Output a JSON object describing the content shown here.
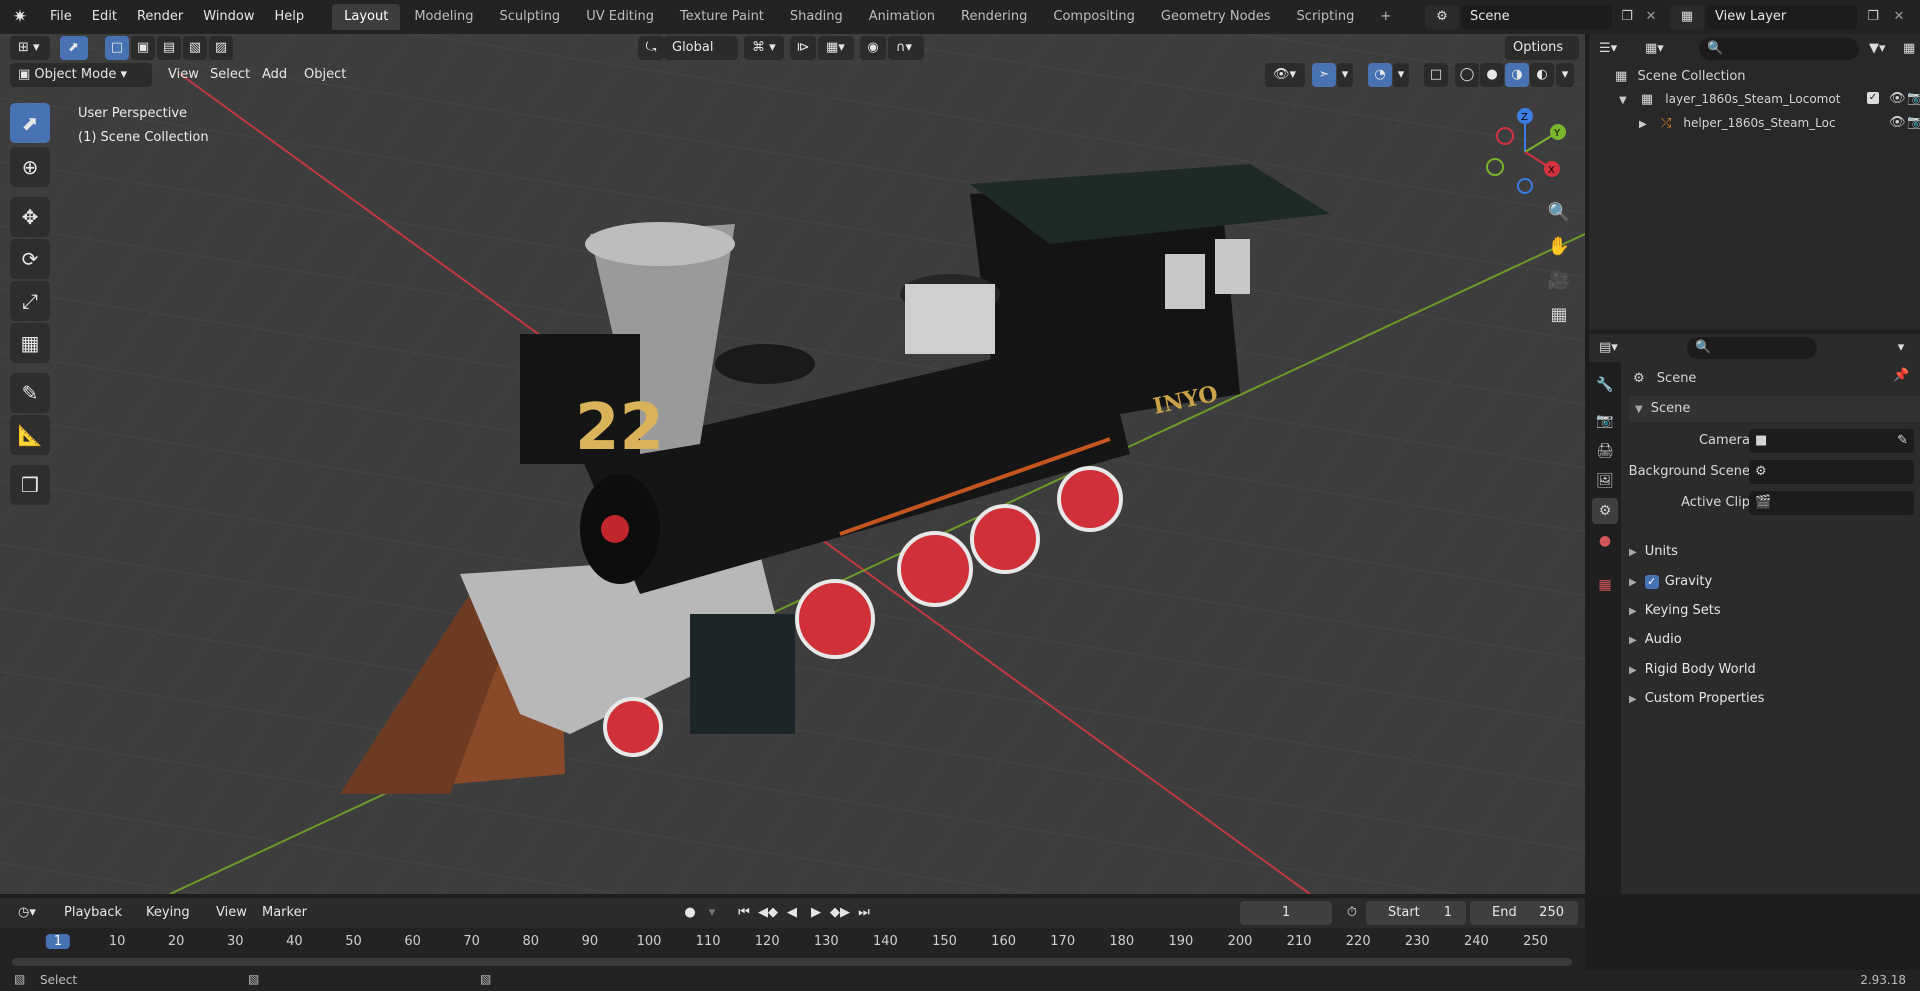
{
  "topbar": {
    "menus": [
      "File",
      "Edit",
      "Render",
      "Window",
      "Help"
    ],
    "workspaces": [
      "Layout",
      "Modeling",
      "Sculpting",
      "UV Editing",
      "Texture Paint",
      "Shading",
      "Animation",
      "Rendering",
      "Compositing",
      "Geometry Nodes",
      "Scripting"
    ],
    "active_workspace": "Layout",
    "add_tab": "+",
    "scene": "Scene",
    "view_layer": "View Layer"
  },
  "viewport": {
    "mode": "Object Mode",
    "menus": [
      "View",
      "Select",
      "Add",
      "Object"
    ],
    "transform_orientation": "Global",
    "options_label": "Options",
    "perspective_label": "User Perspective",
    "collection_label": "(1) Scene Collection",
    "model_text_number": "22",
    "model_text_name": "INYO",
    "gizmo": {
      "x": "X",
      "y": "Y",
      "z": "Z"
    },
    "colors": {
      "background": "#3d3d3d",
      "grid": "#4a4a4a",
      "x_axis": "#c0393f",
      "y_axis": "#6d9a2a",
      "accent": "#4772b3"
    }
  },
  "outliner": {
    "root": "Scene Collection",
    "items": [
      {
        "label": "layer_1860s_Steam_Locomot",
        "indent": 1
      },
      {
        "label": "helper_1860s_Steam_Loc",
        "indent": 2
      }
    ]
  },
  "properties": {
    "breadcrumb": "Scene",
    "panel_title": "Scene",
    "fields": [
      {
        "label": "Camera"
      },
      {
        "label": "Background Scene"
      },
      {
        "label": "Active Clip"
      }
    ],
    "sections": [
      "Units",
      "Gravity",
      "Keying Sets",
      "Audio",
      "Rigid Body World",
      "Custom Properties"
    ],
    "gravity_checked": true
  },
  "timeline": {
    "menus": [
      "Playback",
      "Keying",
      "View",
      "Marker"
    ],
    "current_frame": "1",
    "start_label": "Start",
    "start_value": "1",
    "end_label": "End",
    "end_value": "250",
    "ticks": [
      "1",
      "10",
      "20",
      "30",
      "40",
      "50",
      "60",
      "70",
      "80",
      "90",
      "100",
      "110",
      "120",
      "130",
      "140",
      "150",
      "160",
      "170",
      "180",
      "190",
      "200",
      "210",
      "220",
      "230",
      "240",
      "250"
    ]
  },
  "statusbar": {
    "left": "Select",
    "version": "2.93.18"
  }
}
